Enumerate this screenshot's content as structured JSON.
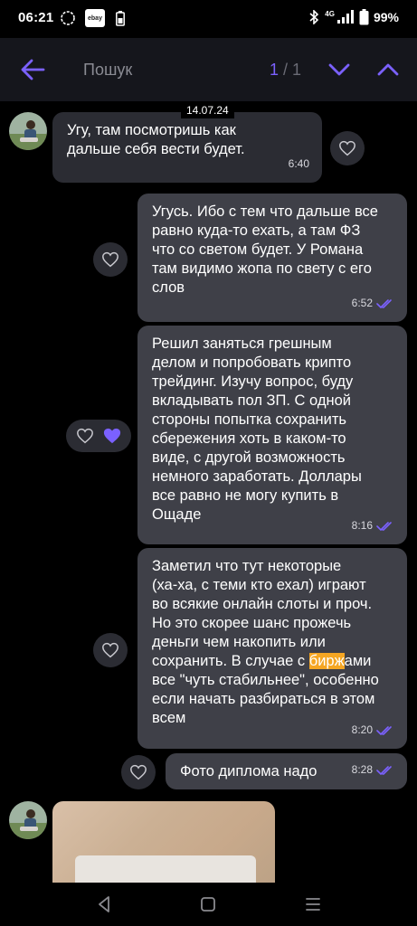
{
  "status_bar": {
    "time": "06:21",
    "app_icons": [
      "signal-app-icon",
      "ebay-icon",
      "battery-saver-icon"
    ],
    "ebay_label": "ebay",
    "network_label": "4G",
    "battery": "99%"
  },
  "search": {
    "placeholder": "Пошук",
    "value": "",
    "current": "1",
    "separator": " / ",
    "total": "1"
  },
  "date_label": "14.07.24",
  "messages": [
    {
      "direction": "incoming",
      "text": "Угу, там посмотришь как\nдальше себя вести будет.",
      "time": "6:40",
      "liked": false
    },
    {
      "direction": "outgoing",
      "text": "Угусь. Ибо с тем что дальше все\nравно куда-то ехать, а там ФЗ\nчто со светом будет. У Романа\nтам видимо жопа по свету с его\nслов",
      "time": "6:52",
      "read": true
    },
    {
      "direction": "outgoing",
      "text": "Решил заняться грешным\nделом и попробовать крипто\nтрейдинг. Изучу вопрос, буду\nвкладывать пол ЗП. С одной\nстороны попытка сохранить\nсбережения хоть в каком-то\nвиде, с другой возможность\nнемного заработать. Доллары\nвсе равно не могу купить в\nОщаде",
      "time": "8:16",
      "read": true,
      "reaction": "purple-heart"
    },
    {
      "direction": "outgoing",
      "text_before": "Заметил что тут некоторые\n(ха-ха, с теми кто ехал) играют\nво всякие онлайн слоты и проч.\nНо это скорее шанс прожечь\nденьги чем накопить или\nсохранить. В случае с ",
      "highlight": "бирж",
      "text_after": "ами\nвсе \"чуть стабильнее\", особенно\nесли начать разбираться в этом\nвсем",
      "time": "8:20",
      "read": true
    },
    {
      "direction": "outgoing",
      "text": "Фото диплома надо",
      "time": "8:28",
      "read": true
    }
  ],
  "colors": {
    "accent": "#7b61ff",
    "incoming_bubble": "#2b2c33",
    "outgoing_bubble": "#3f4048",
    "search_highlight": "#f5a623",
    "header_bg": "#15161c"
  }
}
